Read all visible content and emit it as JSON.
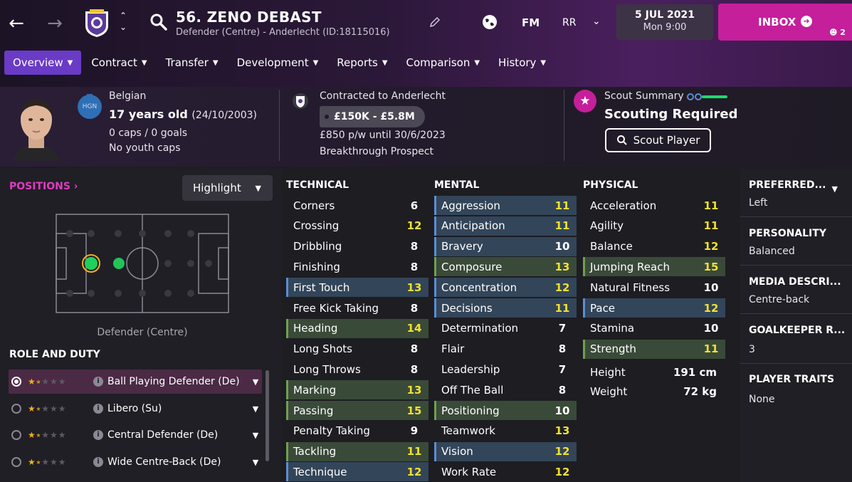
{
  "header": {
    "player_name": "56. ZENO DEBAST",
    "player_sub": "Defender (Centre) - Anderlecht (ID:18115016)",
    "fm_label": "FM",
    "rr_label": "RR",
    "date": "5 JUL 2021",
    "time": "Mon 9:00",
    "inbox_label": "INBOX",
    "inbox_count": "2"
  },
  "tabs": [
    {
      "label": "Overview",
      "active": true
    },
    {
      "label": "Contract"
    },
    {
      "label": "Transfer"
    },
    {
      "label": "Development"
    },
    {
      "label": "Reports"
    },
    {
      "label": "Comparison"
    },
    {
      "label": "History"
    }
  ],
  "profile": {
    "nationality": "Belgian",
    "age": "17 years old",
    "dob": "(24/10/2003)",
    "caps": "0 caps / 0 goals",
    "youth_caps": "No youth caps",
    "flag_text": "HGN",
    "contract": "Contracted to Anderlecht",
    "value": "£150K - £5.8M",
    "wage": "£850 p/w until 30/6/2023",
    "prospect": "Breakthrough Prospect",
    "scout_title": "Scout Summary",
    "scout_status": "Scouting Required",
    "scout_button": "Scout Player"
  },
  "positions": {
    "title": "POSITIONS",
    "highlight_label": "Highlight",
    "position_label": "Defender (Centre)",
    "role_title": "ROLE AND DUTY",
    "roles": [
      {
        "name": "Ball Playing Defender (De)",
        "stars": 1.5,
        "selected": true
      },
      {
        "name": "Libero (Su)",
        "stars": 1.5
      },
      {
        "name": "Central Defender (De)",
        "stars": 1.5
      },
      {
        "name": "Wide Centre-Back (De)",
        "stars": 1.5
      }
    ]
  },
  "attributes": {
    "technical": {
      "title": "TECHNICAL",
      "items": [
        {
          "name": "Corners",
          "value": "6",
          "hl": ""
        },
        {
          "name": "Crossing",
          "value": "12",
          "hl": ""
        },
        {
          "name": "Dribbling",
          "value": "8",
          "hl": ""
        },
        {
          "name": "Finishing",
          "value": "8",
          "hl": ""
        },
        {
          "name": "First Touch",
          "value": "13",
          "hl": "blue"
        },
        {
          "name": "Free Kick Taking",
          "value": "8",
          "hl": ""
        },
        {
          "name": "Heading",
          "value": "14",
          "hl": "green"
        },
        {
          "name": "Long Shots",
          "value": "8",
          "hl": ""
        },
        {
          "name": "Long Throws",
          "value": "8",
          "hl": ""
        },
        {
          "name": "Marking",
          "value": "13",
          "hl": "green"
        },
        {
          "name": "Passing",
          "value": "15",
          "hl": "green"
        },
        {
          "name": "Penalty Taking",
          "value": "9",
          "hl": ""
        },
        {
          "name": "Tackling",
          "value": "11",
          "hl": "green"
        },
        {
          "name": "Technique",
          "value": "12",
          "hl": "blue"
        }
      ]
    },
    "mental": {
      "title": "MENTAL",
      "items": [
        {
          "name": "Aggression",
          "value": "11",
          "hl": "blue"
        },
        {
          "name": "Anticipation",
          "value": "11",
          "hl": "blue"
        },
        {
          "name": "Bravery",
          "value": "10",
          "hl": "blue"
        },
        {
          "name": "Composure",
          "value": "13",
          "hl": "green"
        },
        {
          "name": "Concentration",
          "value": "12",
          "hl": "blue"
        },
        {
          "name": "Decisions",
          "value": "11",
          "hl": "blue"
        },
        {
          "name": "Determination",
          "value": "7",
          "hl": ""
        },
        {
          "name": "Flair",
          "value": "8",
          "hl": ""
        },
        {
          "name": "Leadership",
          "value": "7",
          "hl": ""
        },
        {
          "name": "Off The Ball",
          "value": "8",
          "hl": ""
        },
        {
          "name": "Positioning",
          "value": "10",
          "hl": "green"
        },
        {
          "name": "Teamwork",
          "value": "13",
          "hl": ""
        },
        {
          "name": "Vision",
          "value": "12",
          "hl": "blue"
        },
        {
          "name": "Work Rate",
          "value": "12",
          "hl": ""
        }
      ]
    },
    "physical": {
      "title": "PHYSICAL",
      "items": [
        {
          "name": "Acceleration",
          "value": "11",
          "hl": ""
        },
        {
          "name": "Agility",
          "value": "11",
          "hl": ""
        },
        {
          "name": "Balance",
          "value": "12",
          "hl": ""
        },
        {
          "name": "Jumping Reach",
          "value": "15",
          "hl": "green"
        },
        {
          "name": "Natural Fitness",
          "value": "10",
          "hl": ""
        },
        {
          "name": "Pace",
          "value": "12",
          "hl": "blue"
        },
        {
          "name": "Stamina",
          "value": "10",
          "hl": ""
        },
        {
          "name": "Strength",
          "value": "11",
          "hl": "green"
        }
      ],
      "height_label": "Height",
      "height_value": "191 cm",
      "weight_label": "Weight",
      "weight_value": "72 kg"
    }
  },
  "info": {
    "preferred_title": "PREFERRED...",
    "preferred_value": "Left",
    "personality_title": "PERSONALITY",
    "personality_value": "Balanced",
    "media_title": "MEDIA DESCRI...",
    "media_value": "Centre-back",
    "gk_title": "GOALKEEPER R...",
    "gk_value": "3",
    "traits_title": "PLAYER TRAITS",
    "traits_value": "None"
  },
  "colors": {
    "accent_purple": "#6a3bc6",
    "inbox_pink": "#c51f9b",
    "value_yellow": "#f0e130",
    "key_blue": "#5a8ed2",
    "pref_green": "#6fa04f"
  }
}
